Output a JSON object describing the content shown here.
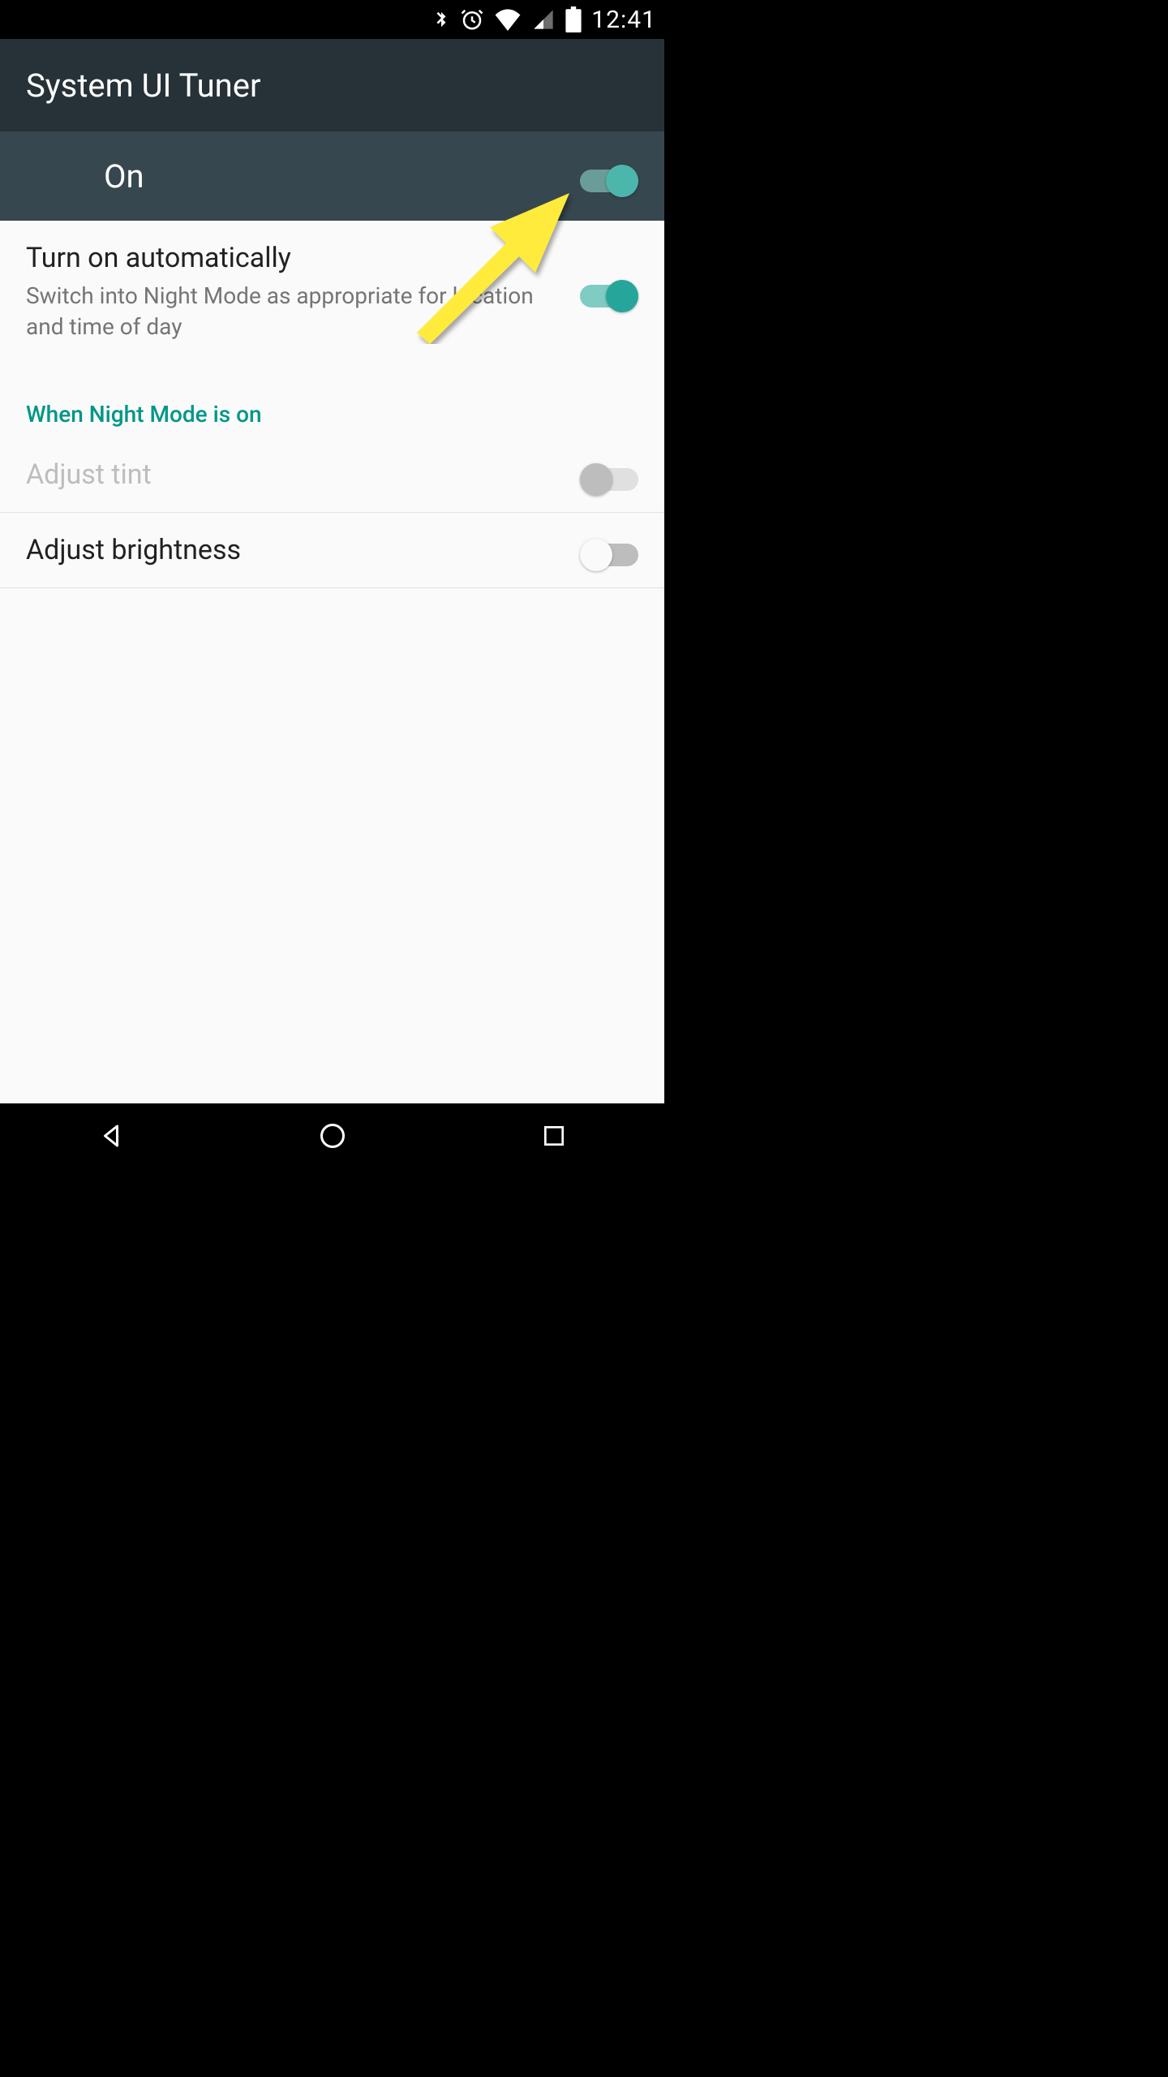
{
  "status_bar": {
    "time": "12:41"
  },
  "app_bar": {
    "title": "System UI Tuner"
  },
  "main_toggle": {
    "label": "On",
    "state": "on"
  },
  "settings": {
    "turn_on_auto": {
      "title": "Turn on automatically",
      "subtitle": "Switch into Night Mode as appropriate for location and time of day",
      "state": "on"
    },
    "section_header": "When Night Mode is on",
    "adjust_tint": {
      "title": "Adjust tint",
      "state": "off",
      "disabled": true
    },
    "adjust_brightness": {
      "title": "Adjust brightness",
      "state": "off",
      "disabled": false
    }
  },
  "colors": {
    "accent": "#009688",
    "app_bar_bg": "#263238",
    "toggle_row_bg": "#37474f",
    "arrow": "#ffeb3b"
  }
}
